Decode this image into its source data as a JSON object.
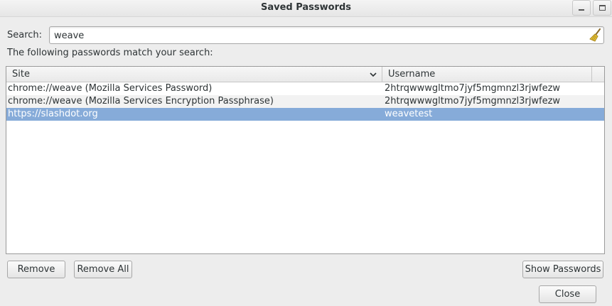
{
  "window": {
    "title": "Saved Passwords"
  },
  "search": {
    "label": "Search:",
    "value": "weave",
    "clear_icon": "broom-icon"
  },
  "results": {
    "message": "The following passwords match your search:"
  },
  "table": {
    "columns": {
      "site": "Site",
      "username": "Username"
    },
    "rows": [
      {
        "site": "chrome://weave (Mozilla Services Password)",
        "username": "2htrqwwwgltmo7jyf5mgmnzl3rjwfezw",
        "selected": false
      },
      {
        "site": "chrome://weave (Mozilla Services Encryption Passphrase)",
        "username": "2htrqwwwgltmo7jyf5mgmnzl3rjwfezw",
        "selected": false
      },
      {
        "site": "https://slashdot.org",
        "username": "weavetest",
        "selected": true
      }
    ]
  },
  "buttons": {
    "remove": "Remove",
    "remove_all": "Remove All",
    "show_passwords": "Show Passwords",
    "close": "Close"
  },
  "colors": {
    "selection": "#86abd9",
    "alt_row": "#f2f2f2",
    "background": "#ededed"
  }
}
